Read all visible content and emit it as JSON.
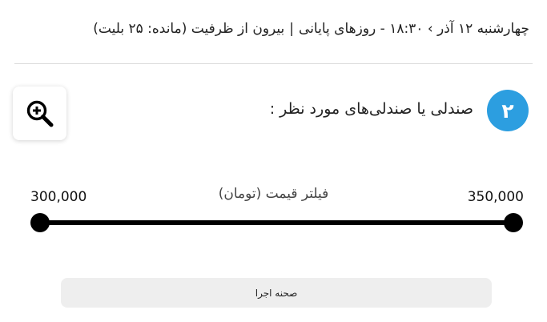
{
  "event_info": {
    "date_time": "چهارشنبه ۱۲ آذر › ۱۸:۳۰ - روزهای پایانی",
    "separator": "|",
    "capacity": "بیرون از ظرفیت (مانده: ۲۵ بلیت)"
  },
  "seat_section": {
    "step_number": "۲",
    "title": "صندلی یا صندلی‌های مورد نظر :",
    "step_color": "#2c9ee0"
  },
  "zoom": {
    "icon": "zoom-in-icon"
  },
  "price_filter": {
    "label": "فیلتر قیمت (تومان)",
    "min_label": "300,000",
    "max_label": "350,000",
    "selected_min_fraction": 0.0,
    "selected_max_fraction": 1.0
  },
  "stage": {
    "label": "صحنه اجرا"
  }
}
